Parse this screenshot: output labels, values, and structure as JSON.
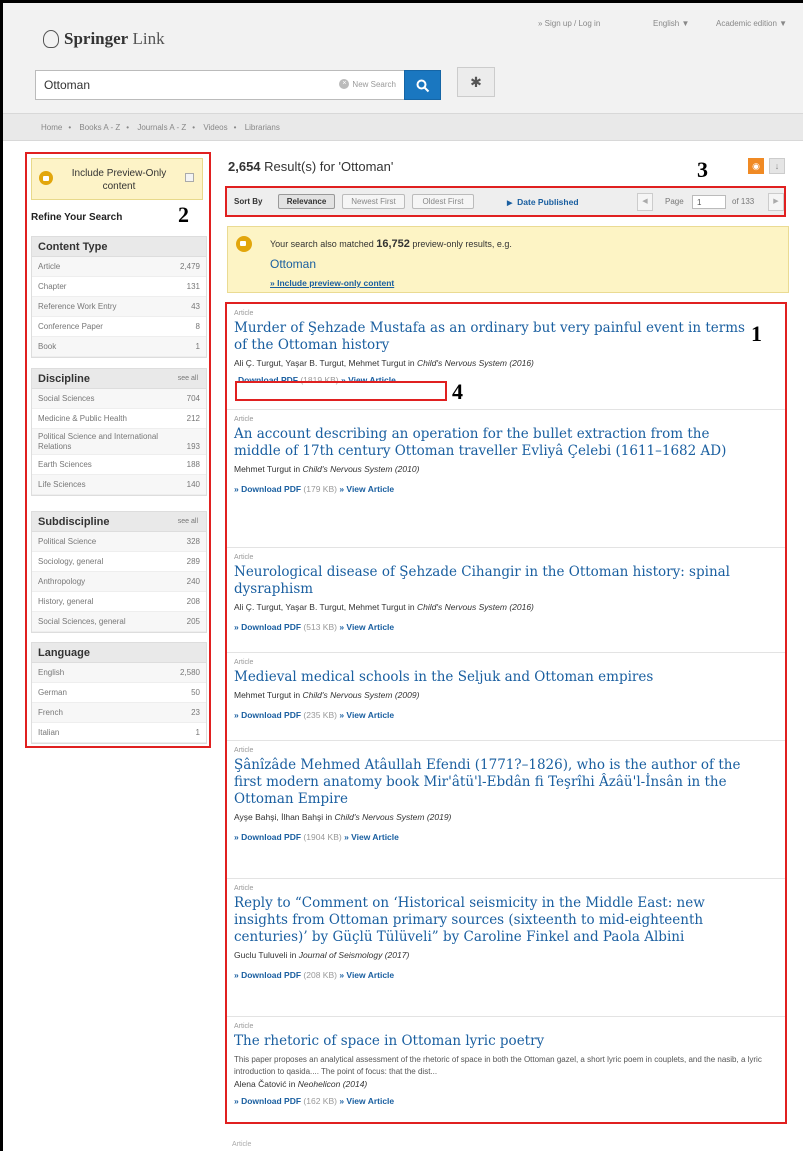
{
  "header": {
    "logo_bold": "Springer",
    "logo_light": "Link",
    "sign_in": "» Sign up / Log in",
    "language": "English ▼",
    "edition": "Academic edition ▼",
    "search_value": "Ottoman",
    "new_search": "New Search"
  },
  "nav": [
    "Home",
    "Books A - Z",
    "Journals A - Z",
    "Videos",
    "Librarians"
  ],
  "sidebar": {
    "preview_label": "Include Preview-Only content",
    "refine": "Refine Your Search",
    "see_all": "see all",
    "content_type": {
      "title": "Content Type",
      "items": [
        {
          "label": "Article",
          "count": "2,479"
        },
        {
          "label": "Chapter",
          "count": "131"
        },
        {
          "label": "Reference Work Entry",
          "count": "43"
        },
        {
          "label": "Conference Paper",
          "count": "8"
        },
        {
          "label": "Book",
          "count": "1"
        }
      ]
    },
    "discipline": {
      "title": "Discipline",
      "items": [
        {
          "label": "Social Sciences",
          "count": "704"
        },
        {
          "label": "Medicine & Public Health",
          "count": "212"
        },
        {
          "label": "Political Science and International Relations",
          "count": "193"
        },
        {
          "label": "Earth Sciences",
          "count": "188"
        },
        {
          "label": "Life Sciences",
          "count": "140"
        }
      ]
    },
    "subdiscipline": {
      "title": "Subdiscipline",
      "items": [
        {
          "label": "Political Science",
          "count": "328"
        },
        {
          "label": "Sociology, general",
          "count": "289"
        },
        {
          "label": "Anthropology",
          "count": "240"
        },
        {
          "label": "History, general",
          "count": "208"
        },
        {
          "label": "Social Sciences, general",
          "count": "205"
        }
      ]
    },
    "language": {
      "title": "Language",
      "items": [
        {
          "label": "English",
          "count": "2,580"
        },
        {
          "label": "German",
          "count": "50"
        },
        {
          "label": "French",
          "count": "23"
        },
        {
          "label": "Italian",
          "count": "1"
        }
      ]
    }
  },
  "results_header": {
    "count": "2,654",
    "text": " Result(s) for 'Ottoman'"
  },
  "sort": {
    "label": "Sort By",
    "relevance": "Relevance",
    "newest": "Newest First",
    "oldest": "Oldest First",
    "date_published": "Date Published",
    "page_label": "Page",
    "page_value": "1",
    "of_pages": "of 133"
  },
  "notice": {
    "pre": "Your search also matched ",
    "count": "16,752",
    "post": " preview-only results, e.g.",
    "example": "Ottoman",
    "include_link": "» Include preview-only content"
  },
  "annotations": {
    "n1": "1",
    "n2": "2",
    "n3": "3",
    "n4": "4"
  },
  "results": [
    {
      "type": "Article",
      "title": "Murder of Şehzade Mustafa as an ordinary but very painful event in terms of the Ottoman history",
      "authors": "Ali Ç. Turgut, Yaşar B. Turgut, Mehmet Turgut in ",
      "journal": "Child's Nervous System (2016)",
      "snippet": "",
      "pdf": "Download PDF",
      "size": " (1819 KB) ",
      "view": "» View Article"
    },
    {
      "type": "Article",
      "title": "An account describing an operation for the bullet extraction from the middle of 17th century Ottoman traveller Evliyâ Çelebi (1611–1682 AD)",
      "authors": "Mehmet Turgut in ",
      "journal": "Child's Nervous System (2010)",
      "snippet": "",
      "pdf": "» Download PDF",
      "size": " (179 KB) ",
      "view": "» View Article"
    },
    {
      "type": "Article",
      "title": "Neurological disease of Şehzade Cihangir in the Ottoman history: spinal dysraphism",
      "authors": "Ali Ç. Turgut, Yaşar B. Turgut, Mehmet Turgut in ",
      "journal": "Child's Nervous System (2016)",
      "snippet": "",
      "pdf": "» Download PDF",
      "size": " (513 KB) ",
      "view": "» View Article"
    },
    {
      "type": "Article",
      "title": "Medieval medical schools in the Seljuk and Ottoman empires",
      "authors": "Mehmet Turgut in ",
      "journal": "Child's Nervous System (2009)",
      "snippet": "",
      "pdf": "» Download PDF",
      "size": " (235 KB) ",
      "view": "» View Article"
    },
    {
      "type": "Article",
      "title": "Şânîzâde Mehmed Atâullah Efendi (1771?–1826), who is the author of the first modern anatomy book Mir'âtü'l-Ebdân fi Teşrîhi Âzâü'l-İnsân in the Ottoman Empire",
      "authors": "Ayşe Bahşi, İlhan Bahşi in ",
      "journal": "Child's Nervous System (2019)",
      "snippet": "",
      "pdf": "» Download PDF",
      "size": " (1904 KB) ",
      "view": "» View Article"
    },
    {
      "type": "Article",
      "title": "Reply to “Comment on ‘Historical seismicity in the Middle East: new insights from Ottoman primary sources (sixteenth to mid-eighteenth centuries)’ by Güçlü Tülüveli” by Caroline Finkel and Paola Albini",
      "authors": "Guclu Tuluveli in ",
      "journal": "Journal of Seismology (2017)",
      "snippet": "",
      "pdf": "» Download PDF",
      "size": " (208 KB) ",
      "view": "» View Article"
    },
    {
      "type": "Article",
      "title": "The rhetoric of space in Ottoman lyric poetry",
      "authors": "Alena Čatović in ",
      "journal": "Neohelicon (2014)",
      "snippet": "This paper proposes an analytical assessment of the rhetoric of space in both the Ottoman gazel, a short lyric poem in couplets, and the nasib, a lyric introduction to qasida.... The point of focus: that the dist...",
      "pdf": "» Download PDF",
      "size": " (162 KB) ",
      "view": "» View Article"
    }
  ],
  "trailing_type": "Article"
}
